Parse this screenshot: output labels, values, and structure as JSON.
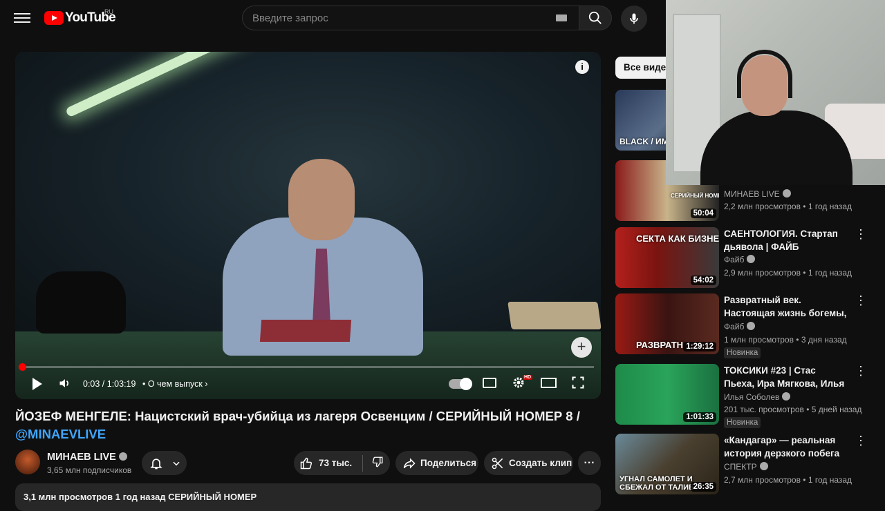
{
  "header": {
    "logo_text": "YouTube",
    "region": "RU",
    "search_placeholder": "Введите запрос"
  },
  "player": {
    "time": "0:03 / 1:03:19",
    "chapter": "• О чем выпуск",
    "progress": 0.001,
    "hd_badge": "HD"
  },
  "video": {
    "title": "ЙОЗЕФ МЕНГЕЛЕ: Нацистский врач-убийца из лагеря Освенцим / СЕРИЙНЫЙ НОМЕР 8 /",
    "hashtag": "@MINAEVLIVE",
    "channel": "МИНАЕВ LIVE",
    "subscribers": "3,65 млн подписчиков",
    "likes": "73 тыс.",
    "share": "Поделиться",
    "clip": "Создать клип",
    "more": "···",
    "description": "3,1 млн просмотров  1 год назад  СЕРИЙНЫЙ НОМЕР"
  },
  "sidebar": {
    "chip": "Все видео",
    "recs": [
      {
        "thumb_text": "BLACK / ИМ ПРИНАД",
        "duration": "",
        "title": "",
        "channel": "",
        "meta": "",
        "badge": ""
      },
      {
        "thumb_text": "СЕРИЙНЫЙ НОМЕР",
        "duration": "50:04",
        "title": "",
        "channel": "МИНАЕВ LIVE",
        "meta": "2,2 млн просмотров • 1 год назад",
        "badge": ""
      },
      {
        "thumb_text": "СЕКТА КАК БИЗНЕС",
        "duration": "54:02",
        "title": "САЕНТОЛОГИЯ. Стартап дьявола | ФАЙБ",
        "channel": "Файб",
        "meta": "2,9 млн просмотров • 1 год назад",
        "badge": ""
      },
      {
        "thumb_text": "РАЗВРАТН",
        "duration": "1:29:12",
        "title": "Развратный век. Настоящая жизнь богемы, о которой не ...",
        "channel": "Файб",
        "meta": "1 млн просмотров • 3 дня назад",
        "badge": "Новинка"
      },
      {
        "thumb_text": "",
        "duration": "1:01:33",
        "title": "ТОКСИКИ #23 | Стас Пьеха, Ира Мягкова, Илья Соболев",
        "channel": "Илья Соболев",
        "meta": "201 тыс. просмотров • 5 дней назад",
        "badge": "Новинка"
      },
      {
        "thumb_text": "УГНАЛ САМОЛЕТ И СБЕЖАЛ ОТ ТАЛИБ",
        "duration": "26:35",
        "title": "«Кандагар» — реальная история дерзкого побега ...",
        "channel": "СПЕКТР",
        "meta": "2,7 млн просмотров • 1 год назад",
        "badge": ""
      }
    ]
  },
  "colors": {
    "accent": "#ff0000",
    "link": "#3ea6ff",
    "background": "#0f0f0f"
  }
}
